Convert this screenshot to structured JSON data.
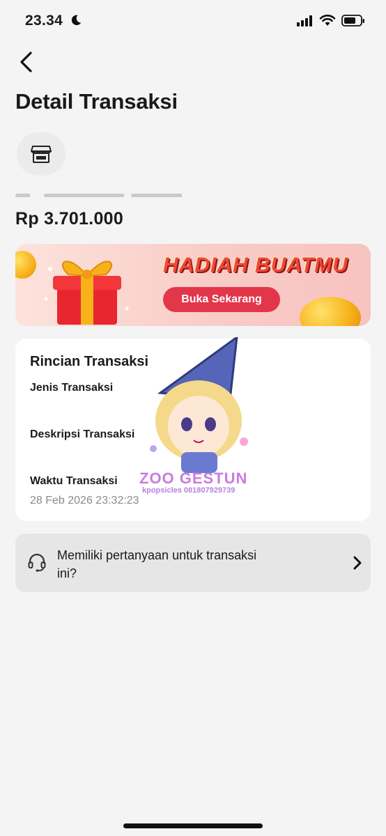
{
  "status_bar": {
    "time": "23.34",
    "icons": [
      "moon-icon",
      "signal-icon",
      "wifi-icon",
      "battery-icon"
    ]
  },
  "header": {
    "back_icon": "chevron-left-icon",
    "title": "Detail Transaksi"
  },
  "transaction": {
    "merchant_icon": "store-icon",
    "amount": "Rp 3.701.000"
  },
  "promo": {
    "title": "HADIAH BUATMU",
    "button_label": "Buka Sekarang"
  },
  "details": {
    "title": "Rincian Transaksi",
    "fields": [
      {
        "label": "Jenis Transaksi",
        "value": ""
      },
      {
        "label": "Deskripsi Transaksi",
        "value": ""
      },
      {
        "label": "Waktu Transaksi",
        "value": "28 Feb 2026 23:32:23"
      }
    ]
  },
  "help": {
    "icon": "headset-icon",
    "text": "Memiliki pertanyaan untuk transaksi ini?",
    "chevron_icon": "chevron-right-icon"
  },
  "watermark": {
    "sticker_text": "ZOO GESTUN",
    "sticker_sub": "kpopsicles 081807929739"
  },
  "colors": {
    "background": "#f4f4f4",
    "card": "#ffffff",
    "promo_accent": "#e2364a",
    "muted_text": "#8a8a8a"
  }
}
